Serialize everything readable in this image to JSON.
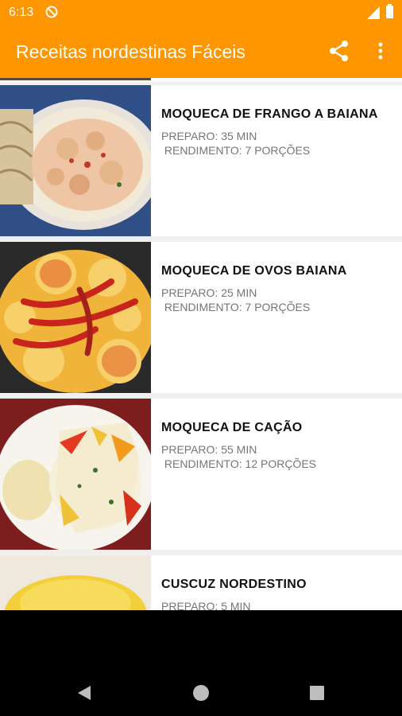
{
  "status_bar": {
    "time": "6:13",
    "icons": [
      "do-not-disturb-icon",
      "signal-icon",
      "battery-icon"
    ]
  },
  "toolbar": {
    "title": "Receitas nordestinas Fáceis",
    "actions": [
      "share-icon",
      "more-vert-icon"
    ]
  },
  "colors": {
    "primary": "#fd9601",
    "text_primary": "#111111",
    "text_secondary": "#757575",
    "divider": "#efefef"
  },
  "recipes": [
    {
      "title": "MOQUECA DE FRANGO A BAIANA",
      "prep": "PREPARO: 35 MIN",
      "yield": " RENDIMENTO: 7 PORÇÕES"
    },
    {
      "title": "MOQUECA DE OVOS BAIANA",
      "prep": "PREPARO: 25 MIN",
      "yield": " RENDIMENTO: 7 PORÇÕES"
    },
    {
      "title": "MOQUECA DE CAÇÃO",
      "prep": "PREPARO: 55 MIN",
      "yield": " RENDIMENTO: 12 PORÇÕES"
    },
    {
      "title": "CUSCUZ NORDESTINO",
      "prep": "PREPARO: 5 MIN"
    }
  ],
  "nav_bar": [
    "back-icon",
    "home-icon",
    "recents-icon"
  ]
}
